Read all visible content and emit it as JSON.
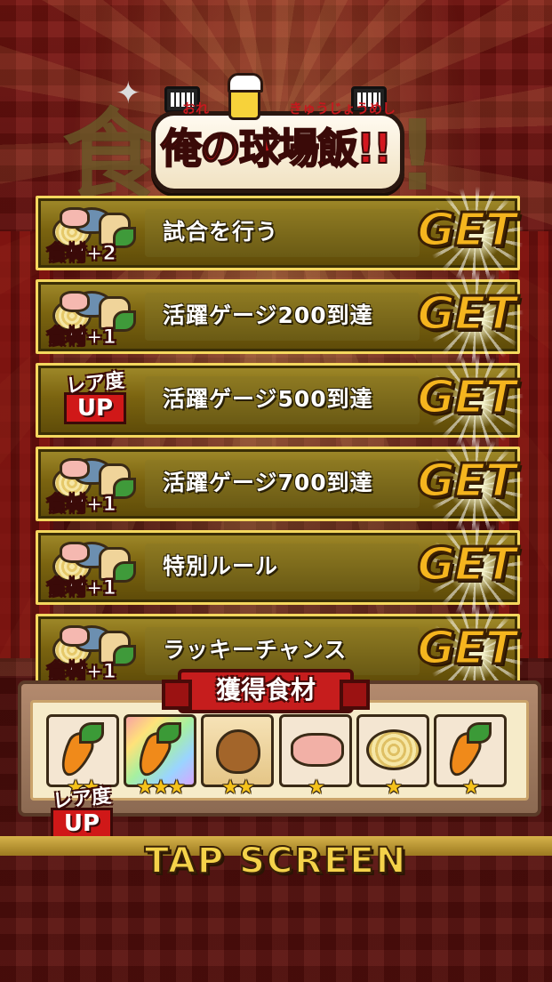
{
  "logo": {
    "ruby_left": "おれ",
    "ruby_right": "きゅうじょうめし",
    "title": "俺の球場飯!!"
  },
  "background_title": "食GET!",
  "rows": [
    {
      "icon": "ingredient",
      "reward": "食材+2",
      "label": "試合を行う",
      "action": "GET"
    },
    {
      "icon": "ingredient",
      "reward": "食材+1",
      "label": "活躍ゲージ200到達",
      "action": "GET"
    },
    {
      "icon": "rarity",
      "reward_top": "レア度",
      "reward_bottom": "UP",
      "label": "活躍ゲージ500到達",
      "action": "GET"
    },
    {
      "icon": "ingredient",
      "reward": "食材+1",
      "label": "活躍ゲージ700到達",
      "action": "GET"
    },
    {
      "icon": "ingredient",
      "reward": "食材+1",
      "label": "特別ルール",
      "action": "GET"
    },
    {
      "icon": "ingredient",
      "reward": "食材+1",
      "label": "ラッキーチャンス",
      "action": "GET"
    }
  ],
  "panel": {
    "title": "獲得食材",
    "items": [
      {
        "name": "carrot",
        "stars": "★★",
        "bg": "plain"
      },
      {
        "name": "carrot",
        "stars": "★★★",
        "bg": "rainbow"
      },
      {
        "name": "onion",
        "stars": "★★",
        "bg": "gold"
      },
      {
        "name": "meat",
        "stars": "★",
        "bg": "plain"
      },
      {
        "name": "noodle",
        "stars": "★",
        "bg": "plain"
      },
      {
        "name": "carrot",
        "stars": "★",
        "bg": "plain"
      }
    ],
    "rare_badge_top": "レア度",
    "rare_badge_bottom": "UP"
  },
  "footer": {
    "tap_label": "TAP SCREEN"
  },
  "colors": {
    "get_text": "#f5b51e",
    "row_border": "#f4d75e",
    "panel_title_bg": "#c61d1d",
    "tap_text": "#f4d24a"
  }
}
